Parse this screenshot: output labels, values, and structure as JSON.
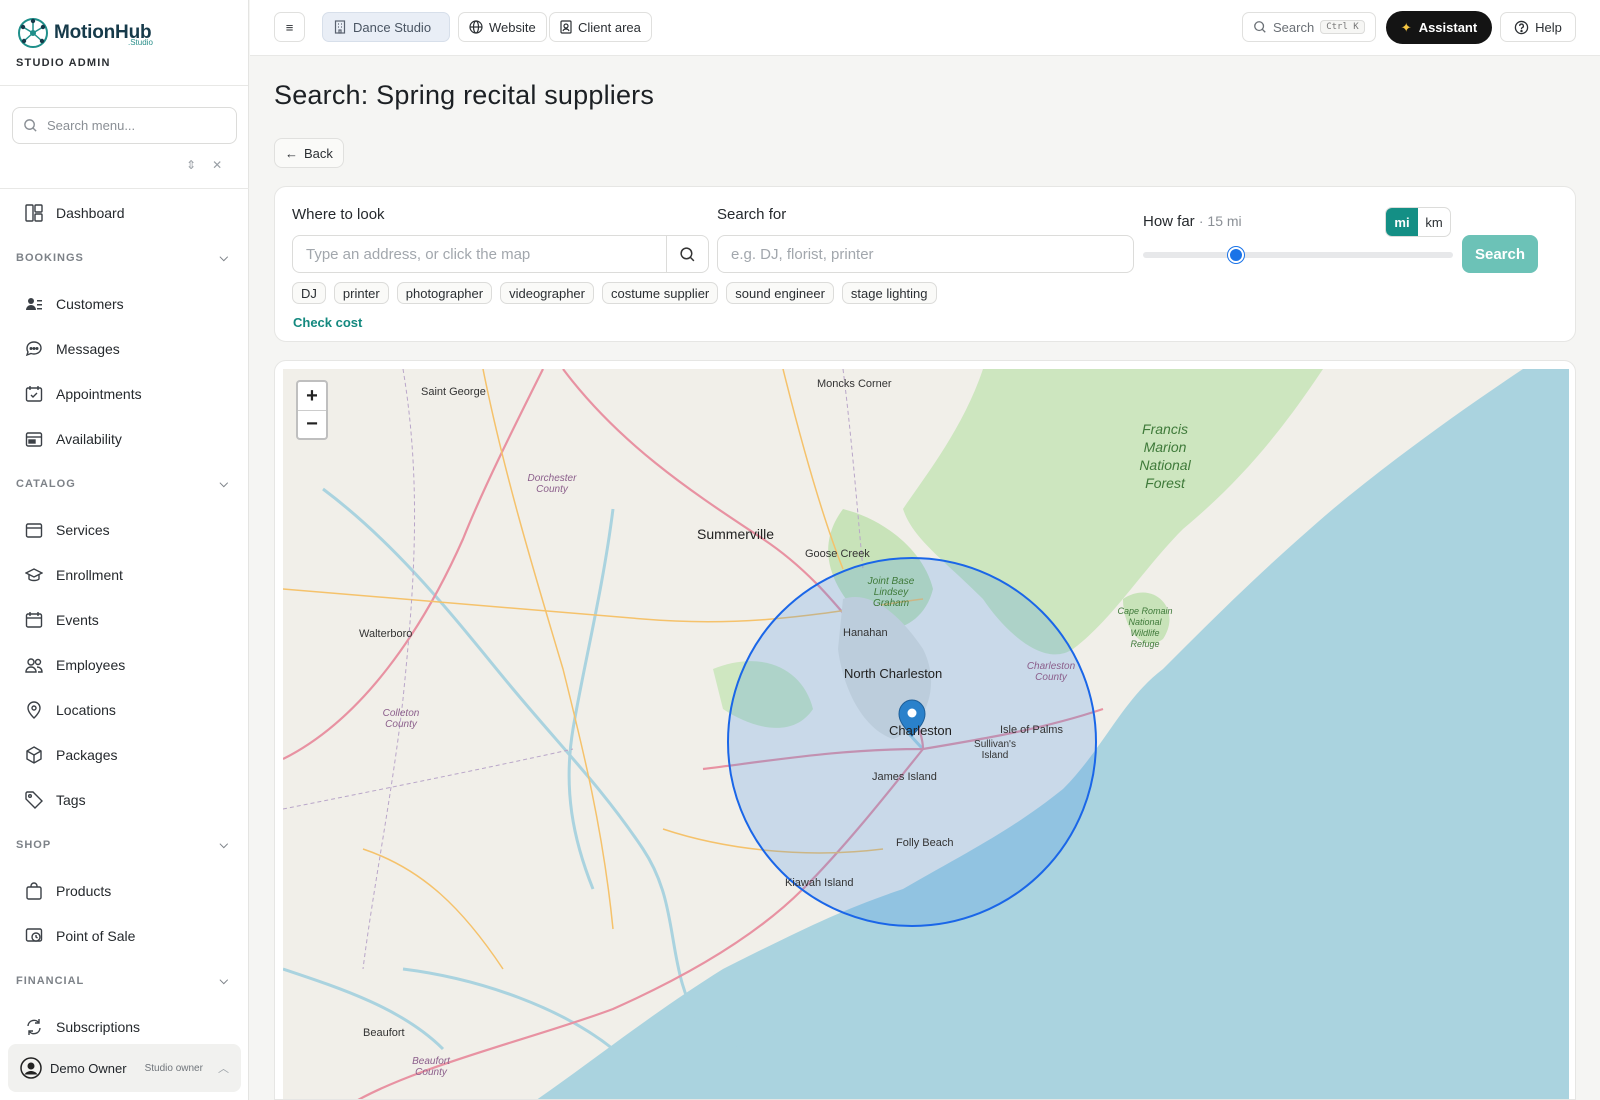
{
  "brand": {
    "name": "MotionHub",
    "sub": ".Studio",
    "role": "STUDIO ADMIN"
  },
  "sidebar": {
    "search_placeholder": "Search menu...",
    "dashboard": "Dashboard",
    "sections": [
      {
        "title": "BOOKINGS",
        "items": [
          {
            "label": "Customers",
            "icon": "customers-icon"
          },
          {
            "label": "Messages",
            "icon": "messages-icon"
          },
          {
            "label": "Appointments",
            "icon": "appointments-icon"
          },
          {
            "label": "Availability",
            "icon": "availability-icon"
          }
        ]
      },
      {
        "title": "CATALOG",
        "items": [
          {
            "label": "Services",
            "icon": "services-icon"
          },
          {
            "label": "Enrollment",
            "icon": "enrollment-icon"
          },
          {
            "label": "Events",
            "icon": "events-icon"
          },
          {
            "label": "Employees",
            "icon": "employees-icon"
          },
          {
            "label": "Locations",
            "icon": "location-pin-icon"
          },
          {
            "label": "Packages",
            "icon": "package-icon"
          },
          {
            "label": "Tags",
            "icon": "tag-icon"
          }
        ]
      },
      {
        "title": "SHOP",
        "items": [
          {
            "label": "Products",
            "icon": "shopping-bag-icon"
          },
          {
            "label": "Point of Sale",
            "icon": "pos-icon"
          }
        ]
      },
      {
        "title": "FINANCIAL",
        "items": [
          {
            "label": "Subscriptions",
            "icon": "refresh-icon"
          }
        ]
      }
    ],
    "user": {
      "name": "Demo Owner",
      "role": "Studio owner"
    }
  },
  "topbar": {
    "studio": "Dance Studio",
    "website": "Website",
    "client_area": "Client area",
    "search": "Search",
    "shortcut": "Ctrl K",
    "assistant": "Assistant",
    "help": "Help"
  },
  "page": {
    "title": "Search: Spring recital suppliers",
    "back": "Back"
  },
  "form": {
    "where_label": "Where to look",
    "where_placeholder": "Type an address, or click the map",
    "what_label": "Search for",
    "what_placeholder": "e.g. DJ, florist, printer",
    "howfar_label": "How far",
    "howfar_value": "15 mi",
    "radius": 15,
    "radius_max": 50,
    "units": [
      "mi",
      "km"
    ],
    "unit_selected": "mi",
    "search_button": "Search",
    "chips": [
      "DJ",
      "printer",
      "photographer",
      "videographer",
      "costume supplier",
      "sound engineer",
      "stage lighting"
    ],
    "check_cost": "Check cost"
  },
  "map": {
    "zoom_in": "+",
    "zoom_out": "−",
    "labels": {
      "moncks": "Moncks Corner",
      "saint_george": "Saint George",
      "dorchester": "Dorchester County",
      "summerville": "Summerville",
      "goose_creek": "Goose Creek",
      "joint_base": "Joint Base Lindsey Graham",
      "hanahan": "Hanahan",
      "north_charleston": "North Charleston",
      "charleston": "Charleston",
      "walterboro": "Walterboro",
      "colleton": "Colleton County",
      "charleston_county": "Charleston County",
      "isle_of_palms": "Isle of Palms",
      "sullivans": "Sullivan's Island",
      "james_island": "James Island",
      "folly_beach": "Folly Beach",
      "kiawah": "Kiawah Island",
      "beaufort": "Beaufort",
      "beaufort_county": "Beaufort County",
      "francis_marion": "Francis Marion National Forest",
      "cape_romain": "Cape Romain National Wildlife Refuge"
    }
  }
}
